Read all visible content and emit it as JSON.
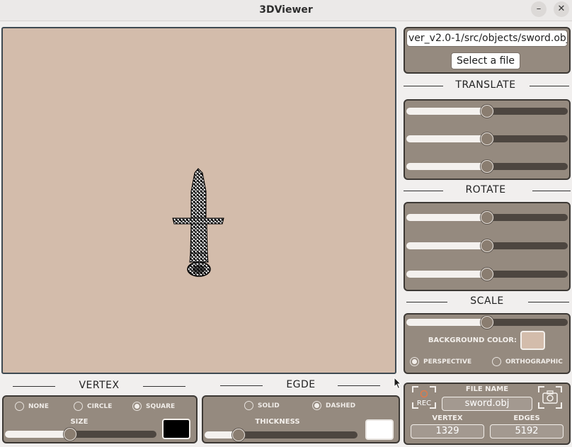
{
  "window": {
    "title": "3DViewer",
    "minimize_glyph": "–",
    "close_glyph": "✕"
  },
  "file": {
    "path_value": "ver_v2.0-1/src/objects/sword.obj",
    "select_button": "Select a file"
  },
  "translate": {
    "header": "TRANSLATE",
    "sliders": [
      0.5,
      0.5,
      0.5
    ]
  },
  "rotate": {
    "header": "ROTATE",
    "sliders": [
      0.5,
      0.5,
      0.5
    ]
  },
  "scale": {
    "header": "SCALE",
    "slider": 0.5,
    "background_color_label": "BACKGROUND COLOR:",
    "background_color": "#d3bcab",
    "projection": {
      "perspective": "PERSPECTIVE",
      "orthographic": "ORTHOGRAPHIC",
      "selected": "perspective"
    }
  },
  "info": {
    "rec_label": "REC",
    "file_name_label": "FILE NAME",
    "file_name": "sword.obj",
    "vertex_label": "VERTEX",
    "vertex_count": "1329",
    "edges_label": "EDGES",
    "edges_count": "5192"
  },
  "vertex": {
    "header": "VERTEX",
    "options": [
      "NONE",
      "CIRCLE",
      "SQUARE"
    ],
    "selected": "SQUARE",
    "size_label": "SIZE",
    "size_value": 0.43,
    "color": "#000000"
  },
  "edge": {
    "header": "EGDE",
    "options": [
      "SOLID",
      "DASHED"
    ],
    "selected": "DASHED",
    "thickness_label": "THICKNESS",
    "thickness_value": 0.22,
    "color": "#ffffff"
  },
  "colors": {
    "viewport_bg": "#d3bcab",
    "panel_bg": "#958a7f",
    "panel_border": "#3d3935"
  }
}
